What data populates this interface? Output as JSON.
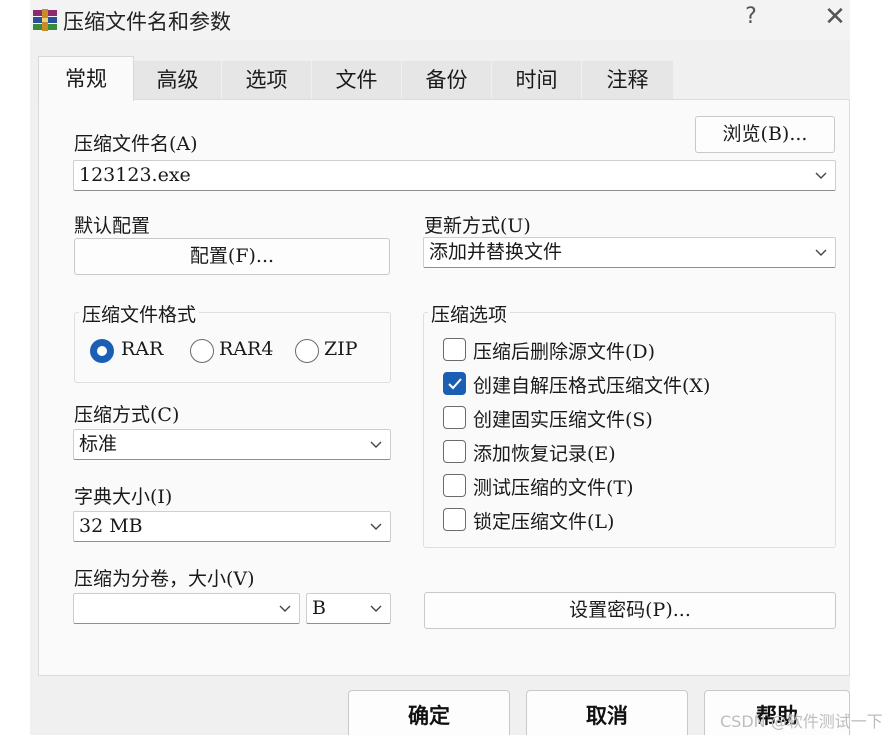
{
  "window": {
    "title": "压缩文件名和参数",
    "help_glyph": "?",
    "close_glyph": "✕"
  },
  "tabs": [
    {
      "label": "常规",
      "active": true
    },
    {
      "label": "高级"
    },
    {
      "label": "选项"
    },
    {
      "label": "文件"
    },
    {
      "label": "备份"
    },
    {
      "label": "时间"
    },
    {
      "label": "注释"
    }
  ],
  "archive_name": {
    "label": "压缩文件名(A)",
    "value": "123123.exe",
    "browse_button": "浏览(B)..."
  },
  "profiles": {
    "label": "默认配置",
    "button": "配置(F)..."
  },
  "update_mode": {
    "label": "更新方式(U)",
    "value": "添加并替换文件"
  },
  "archive_format": {
    "title": "压缩文件格式",
    "options": [
      {
        "label": "RAR",
        "selected": true
      },
      {
        "label": "RAR4"
      },
      {
        "label": "ZIP"
      }
    ]
  },
  "compression_method": {
    "label": "压缩方式(C)",
    "value": "标准"
  },
  "dictionary_size": {
    "label": "字典大小(I)",
    "value": "32 MB"
  },
  "split_volumes": {
    "label": "压缩为分卷，大小(V)",
    "value": "",
    "unit": "B"
  },
  "archiving_options": {
    "title": "压缩选项",
    "items": [
      {
        "label": "压缩后删除源文件(D)",
        "checked": false
      },
      {
        "label": "创建自解压格式压缩文件(X)",
        "checked": true
      },
      {
        "label": "创建固实压缩文件(S)",
        "checked": false
      },
      {
        "label": "添加恢复记录(E)",
        "checked": false
      },
      {
        "label": "测试压缩的文件(T)",
        "checked": false
      },
      {
        "label": "锁定压缩文件(L)",
        "checked": false
      }
    ]
  },
  "set_password_button": "设置密码(P)...",
  "footer": {
    "ok": "确定",
    "cancel": "取消",
    "help": "帮助"
  },
  "watermark": "CSDN @软件测试一下",
  "colors": {
    "accent": "#1b5fb4",
    "panel": "#fafafa",
    "window": "#f0f0f0"
  }
}
